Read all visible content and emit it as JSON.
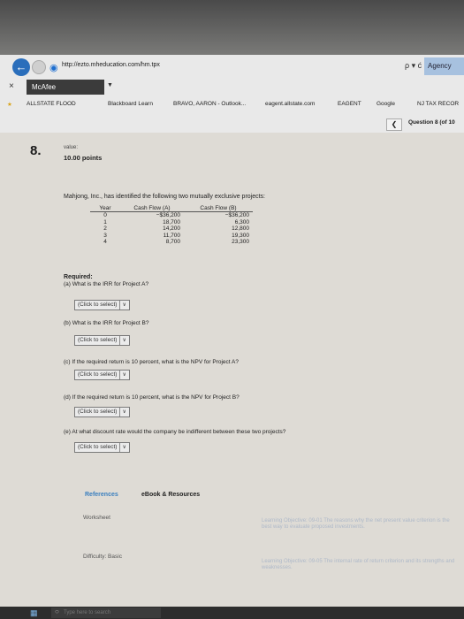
{
  "browser": {
    "url": "http://ezto.mheducation.com/hm.tpx",
    "search_controls": "ρ ▾ ć",
    "agency_tab": "Agency",
    "close_tab": "×",
    "mcafee_label": "McAfee",
    "favorites": [
      "ALLSTATE FLOOD",
      "Blackboard Learn",
      "BRAVO, AARON - Outlook...",
      "eagent.allstate.com",
      "EAGENT",
      "Google",
      "NJ TAX RECOR"
    ],
    "question_nav": "Question 8 (of 10"
  },
  "question": {
    "number": "8.",
    "value_label": "value:",
    "points": "10.00 points",
    "intro": "Mahjong, Inc., has identified the following two mutually exclusive projects:",
    "table": {
      "headers": [
        "Year",
        "Cash Flow (A)",
        "Cash Flow (B)"
      ],
      "rows": [
        [
          "0",
          "−$36,200",
          "−$36,200"
        ],
        [
          "1",
          "18,700",
          "6,300"
        ],
        [
          "2",
          "14,200",
          "12,800"
        ],
        [
          "3",
          "11,700",
          "19,300"
        ],
        [
          "4",
          "8,700",
          "23,300"
        ]
      ]
    },
    "required_label": "Required:",
    "parts": [
      {
        "text": "(a) What is the IRR for Project A?",
        "select": "(Click to select)"
      },
      {
        "text": "(b) What is the IRR for Project B?",
        "select": "(Click to select)"
      },
      {
        "text": "(c) If the required return is 10 percent, what is the NPV for Project A?",
        "select": "(Click to select)"
      },
      {
        "text": "(d) If the required return is 10 percent, what is the NPV for Project B?",
        "select": "(Click to select)"
      },
      {
        "text": "(e) At what discount rate would the company be indifferent between these two projects?",
        "select": "(Click to select)"
      }
    ]
  },
  "footer": {
    "references": "References",
    "ebook": "eBook & Resources",
    "worksheet": "Worksheet",
    "difficulty": "Difficulty: Basic",
    "lo1": "Learning Objective: 09-01 The reasons why the net present value criterion is the best way to evaluate proposed investments.",
    "lo2": "Learning Objective: 09-05 The internal rate of return criterion and its strengths and weaknesses."
  },
  "taskbar": {
    "search_placeholder": "Type here to search"
  },
  "colors": {
    "link_blue": "#3a7fbf",
    "mcafee_bar": "#3b3b3b"
  }
}
